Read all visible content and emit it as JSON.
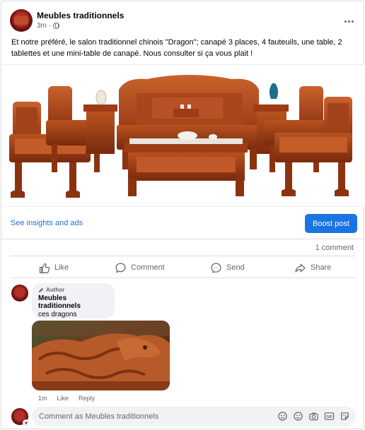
{
  "post": {
    "page_name": "Meubles traditionnels",
    "time": "3m",
    "privacy_icon": "globe-icon",
    "text": "Et notre préféré, le salon traditionnel chinois \"Dragon\"; canapé 3 places, 4 fauteuils, une table, 2 tablettes et une mini-table de canapé. Nous consulter si ça vous plait !"
  },
  "promo": {
    "insights_label": "See insights and ads",
    "boost_label": "Boost post"
  },
  "stats": {
    "comments": "1 comment"
  },
  "actions": [
    {
      "label": "Like",
      "icon": "thumbs-up-icon"
    },
    {
      "label": "Comment",
      "icon": "speech-bubble-icon"
    },
    {
      "label": "Send",
      "icon": "messenger-icon"
    },
    {
      "label": "Share",
      "icon": "share-arrow-icon"
    }
  ],
  "comment": {
    "author_tag": "Author",
    "author": "Meubles traditionnels",
    "text": "ces dragons",
    "time": "1m",
    "like_label": "Like",
    "reply_label": "Reply"
  },
  "composer": {
    "placeholder": "Comment as Meubles traditionnels",
    "icons": [
      "avatar-sticker-icon",
      "emoji-icon",
      "camera-icon",
      "gif-icon",
      "sticker-icon"
    ]
  },
  "colors": {
    "accent": "#1b74e4",
    "link": "#216fdb",
    "muted": "#65676b",
    "wood": "#b54a1e"
  }
}
